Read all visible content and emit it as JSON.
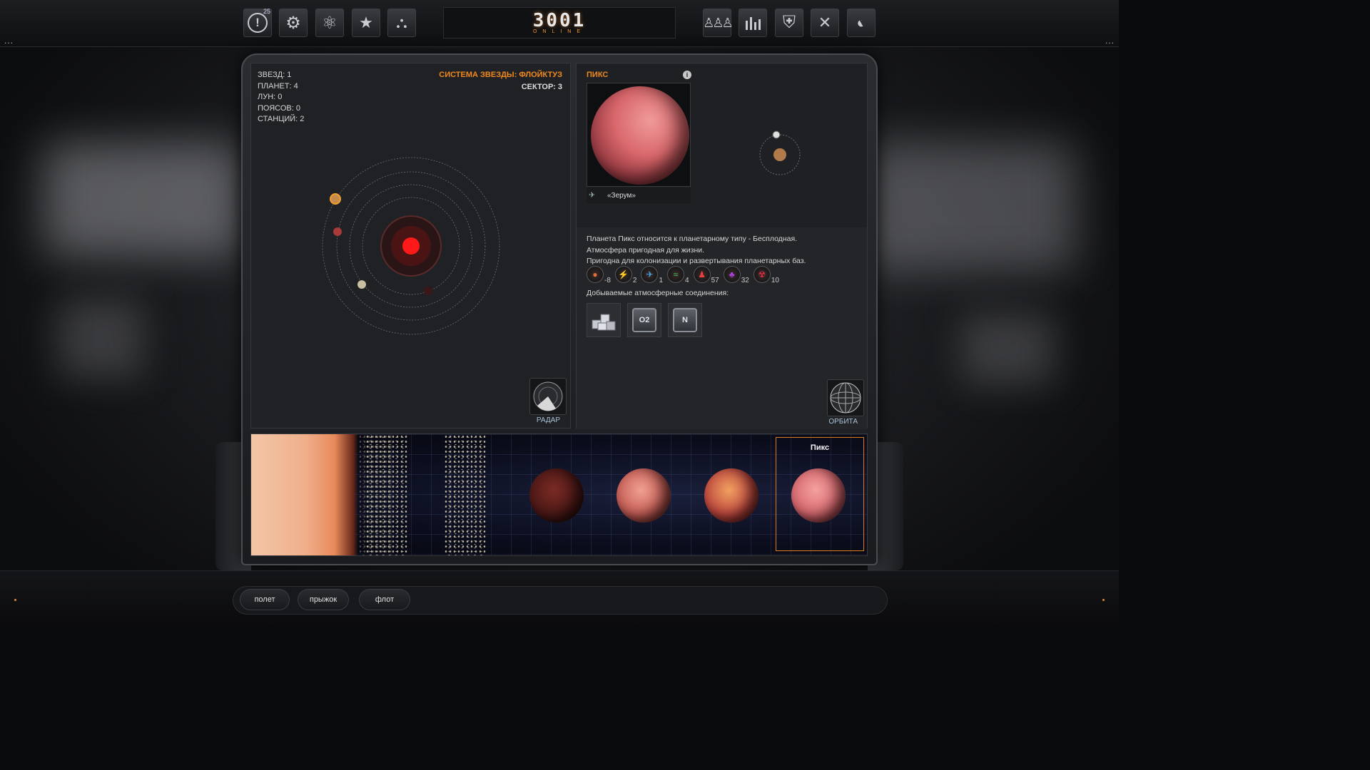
{
  "topbar": {
    "left_buttons": [
      {
        "name": "alerts",
        "icon": "alert-icon",
        "glyph": "!",
        "badge": "25"
      },
      {
        "name": "settings",
        "icon": "gear-icon",
        "glyph": "⚙"
      },
      {
        "name": "science",
        "icon": "atom-icon",
        "glyph": "⚛"
      },
      {
        "name": "favorites",
        "icon": "star-icon",
        "glyph": "★"
      },
      {
        "name": "structure",
        "icon": "hierarchy-icon",
        "glyph": "⛬"
      }
    ],
    "logo": {
      "main": "3001",
      "sub": "ONLINE"
    },
    "right_buttons": [
      {
        "name": "population",
        "icon": "people-icon",
        "glyph": "👥"
      },
      {
        "name": "stats",
        "icon": "bar-chart-icon",
        "glyph": "▮"
      },
      {
        "name": "defense",
        "icon": "shield-icon",
        "glyph": "⛨"
      },
      {
        "name": "fullscreen",
        "icon": "expand-icon",
        "glyph": "✕"
      },
      {
        "name": "satellite",
        "icon": "satellite-dish-icon",
        "glyph": "◐"
      }
    ],
    "menu_dots": "..."
  },
  "system": {
    "stats": [
      "ЗВЕЗД: 1",
      "ПЛАНЕТ: 4",
      "ЛУН: 0",
      "ПОЯСОВ: 0",
      "СТАНЦИЙ: 2"
    ],
    "title": "СИСТЕМА ЗВЕЗДЫ: ФЛОЙКТУЗ",
    "sector": "СЕКТОР: 3",
    "radar_label": "РАДАР"
  },
  "planet": {
    "name": "ПИКС",
    "info": "i",
    "station": "«Зерум»",
    "description": [
      "Планета Пикс относится к планетарному типу - Бесплодная.",
      "Атмосфера пригодная для жизни.",
      "Пригодна для колонизации и развертывания планетарных баз."
    ],
    "resources": [
      {
        "icon": "temperature-icon",
        "glyph": "●",
        "color": "#e0703a",
        "value": "-8"
      },
      {
        "icon": "energy-icon",
        "glyph": "⚡",
        "color": "#f0c020",
        "value": "2"
      },
      {
        "icon": "wind-icon",
        "glyph": "✈",
        "color": "#4aa8e8",
        "value": "1"
      },
      {
        "icon": "seismic-icon",
        "glyph": "≈",
        "color": "#40d060",
        "value": "4"
      },
      {
        "icon": "population-icon",
        "glyph": "♟",
        "color": "#e84040",
        "value": "57"
      },
      {
        "icon": "bio-icon",
        "glyph": "♣",
        "color": "#b040e0",
        "value": "32"
      },
      {
        "icon": "hazard-icon",
        "glyph": "☢",
        "color": "#e03040",
        "value": "10"
      }
    ],
    "compounds_title": "Добываемые атмосферные соединения:",
    "compounds": [
      {
        "icon": "crystals-icon",
        "label": ""
      },
      {
        "icon": "oxygen-icon",
        "label": "O2"
      },
      {
        "icon": "nitrogen-icon",
        "label": "N"
      }
    ],
    "orbit_label": "ОРБИТА"
  },
  "strip": {
    "selected_label": "Пикс"
  },
  "bottom": {
    "buttons": [
      "полет",
      "прыжок",
      "флот"
    ]
  }
}
